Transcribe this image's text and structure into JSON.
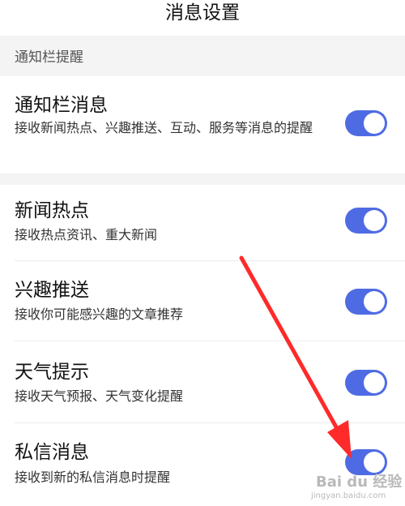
{
  "header": {
    "title": "消息设置"
  },
  "section1": {
    "label": "通知栏提醒"
  },
  "rows": [
    {
      "title": "通知栏消息",
      "desc": "接收新闻热点、兴趣推送、互动、服务等消息的提醒",
      "enabled": true
    },
    {
      "title": "新闻热点",
      "desc": "接收热点资讯、重大新闻",
      "enabled": true
    },
    {
      "title": "兴趣推送",
      "desc": "接收你可能感兴趣的文章推荐",
      "enabled": true
    },
    {
      "title": "天气提示",
      "desc": "接收天气预报、天气变化提醒",
      "enabled": true
    },
    {
      "title": "私信消息",
      "desc": "接收到新的私信消息时提醒",
      "enabled": true
    }
  ],
  "watermark": {
    "text": "Bai du 经验",
    "sub": "jingyan.baidu.com"
  },
  "colors": {
    "toggle_on": "#4f6be4",
    "arrow": "#ff2a2a",
    "section_bg": "#f4f4f4"
  }
}
